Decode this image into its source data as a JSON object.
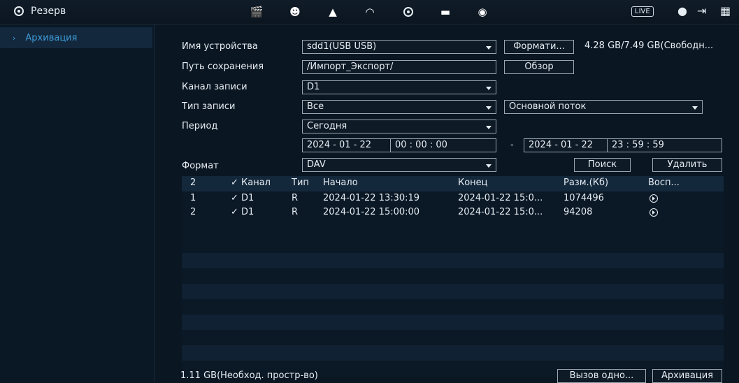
{
  "topbar": {
    "title": "Резерв",
    "live_label": "LIVE",
    "icons": [
      "clapperboard-icon",
      "face-icon",
      "alarm-icon",
      "ptz-icon",
      "backup-icon",
      "monitor-icon",
      "audio-icon",
      "user-icon",
      "logout-icon",
      "qr-icon"
    ]
  },
  "sidebar": {
    "items": [
      {
        "label": "Архивация"
      }
    ]
  },
  "form": {
    "device_label": "Имя устройства",
    "device_value": "sdd1(USB USB)",
    "format_button": "Формати...",
    "free_space": "4.28 GB/7.49 GB(Свободн...",
    "path_label": "Путь сохранения",
    "path_value": "/Импорт_Экспорт/",
    "browse_button": "Обзор",
    "channel_label": "Канал записи",
    "channel_value": "D1",
    "type_label": "Тип записи",
    "type_value": "Все",
    "stream_value": "Основной поток",
    "period_label": "Период",
    "period_value": "Сегодня",
    "start_date": "2024 - 01 - 22",
    "start_time": "00 : 00 : 00",
    "dash": "-",
    "end_date": "2024 - 01 - 22",
    "end_time": "23 : 59 : 59",
    "format_label": "Формат",
    "format_value": "DAV",
    "search_button": "Поиск",
    "delete_button": "Удалить"
  },
  "table": {
    "headers": {
      "num": "2",
      "channel": "✓ Канал",
      "type": "Тип",
      "start": "Начало",
      "end": "Конец",
      "size": "Разм.(Кб)",
      "play": "Восп..."
    },
    "rows": [
      {
        "num": "1",
        "channel": "✓ D1",
        "type": "R",
        "start": "2024-01-22 13:30:19",
        "end": "2024-01-22 15:0...",
        "size": "1074496"
      },
      {
        "num": "2",
        "channel": "✓ D1",
        "type": "R",
        "start": "2024-01-22 15:00:00",
        "end": "2024-01-22 15:0...",
        "size": "94208"
      }
    ]
  },
  "footer": {
    "required_space": "1.11 GB(Необход. простр-во)",
    "call_button": "Вызов одно...",
    "archive_button": "Архивация"
  }
}
